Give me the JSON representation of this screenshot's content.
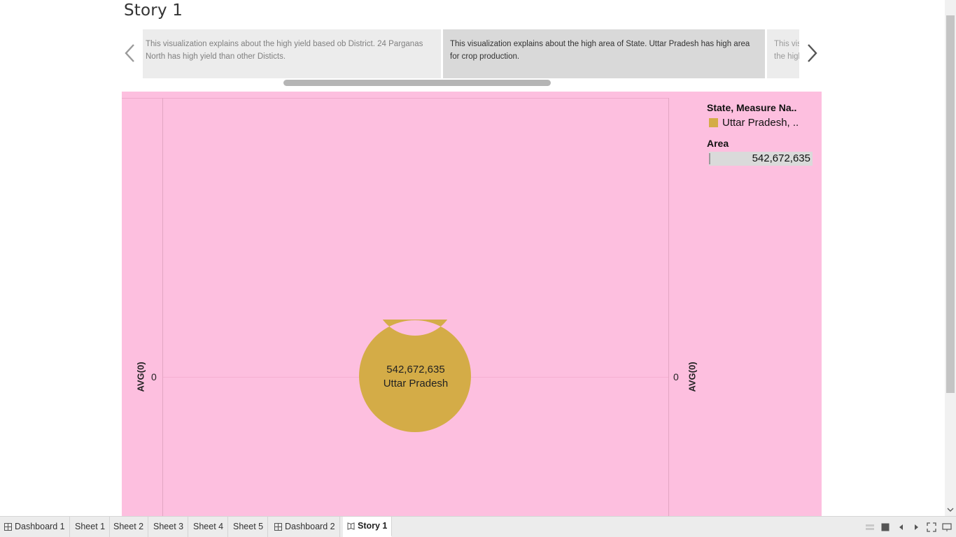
{
  "story": {
    "title": "Story 1"
  },
  "navigator": {
    "captions": [
      "This visualization explains about the high yield based ob District. 24 Parganas North has high yield than other Disticts.",
      "This visualization explains about the high area of State. Uttar Pradesh has high area for crop production.",
      "This visualization explains about the high"
    ],
    "selected_index": 1
  },
  "viz": {
    "axis_title_left": "AVG(0)",
    "axis_title_right": "AVG(0)",
    "tick_left": "0",
    "tick_right": "0",
    "legend_title": "State, Measure Na..",
    "legend_item": "Uttar Pradesh, ..",
    "legend_color": "#d4ac47",
    "area_title": "Area",
    "area_value": "542,672,635",
    "background_color": "#fdbfdf"
  },
  "chart_data": {
    "type": "pie",
    "categories": [
      "Uttar Pradesh"
    ],
    "values": [
      542672635
    ],
    "labels": [
      "542,672,635",
      "Uttar Pradesh"
    ],
    "colors": [
      "#d4ac47"
    ],
    "legend": "top-right"
  },
  "tabs": [
    {
      "label": "Dashboard 1",
      "icon": "dashboard-icon"
    },
    {
      "label": "Sheet 1",
      "icon": ""
    },
    {
      "label": "Sheet 2",
      "icon": ""
    },
    {
      "label": "Sheet 3",
      "icon": ""
    },
    {
      "label": "Sheet 4",
      "icon": ""
    },
    {
      "label": "Sheet 5",
      "icon": ""
    },
    {
      "label": "Dashboard 2",
      "icon": "dashboard-icon"
    },
    {
      "label": "Story 1",
      "icon": "story-icon",
      "active": true
    }
  ]
}
